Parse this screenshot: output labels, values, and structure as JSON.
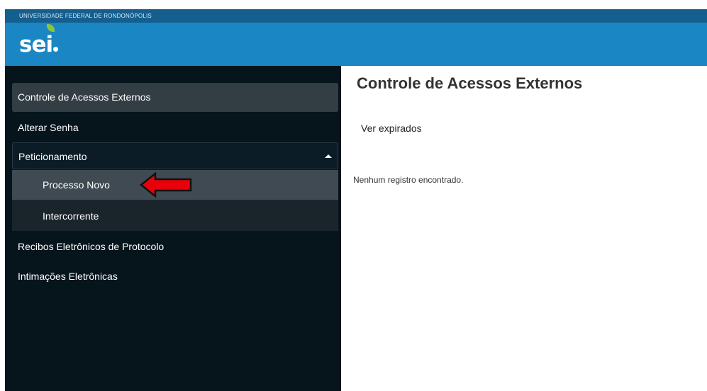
{
  "header": {
    "org_name": "UNIVERSIDADE FEDERAL DE RONDONÓPOLIS",
    "logo_text": "se",
    "logo_i": "i",
    "colors": {
      "header_blue": "#1b86c4",
      "org_bar_blue": "#155f8f",
      "logo_leaf_green": "#8bc53f"
    }
  },
  "sidebar": {
    "colors": {
      "background": "#06141c",
      "active_item": "#333d44",
      "submenu_bg": "#1a242b",
      "submenu_active": "#3f4a52"
    },
    "items": [
      {
        "label": "Controle de Acessos Externos"
      },
      {
        "label": "Alterar Senha"
      },
      {
        "label": "Peticionamento",
        "icon": "caret-up-icon",
        "expanded": true
      },
      {
        "label": "Recibos Eletrônicos de Protocolo"
      },
      {
        "label": "Intimações Eletrônicas"
      }
    ],
    "peticionamento_subitems": [
      {
        "label": "Processo Novo"
      },
      {
        "label": "Intercorrente"
      }
    ]
  },
  "annotation": {
    "icon": "red-arrow-left-icon",
    "color": "#e8000b"
  },
  "main": {
    "title": "Controle de Acessos Externos",
    "ver_expirados": "Ver expirados",
    "empty_message": "Nenhum registro encontrado."
  }
}
